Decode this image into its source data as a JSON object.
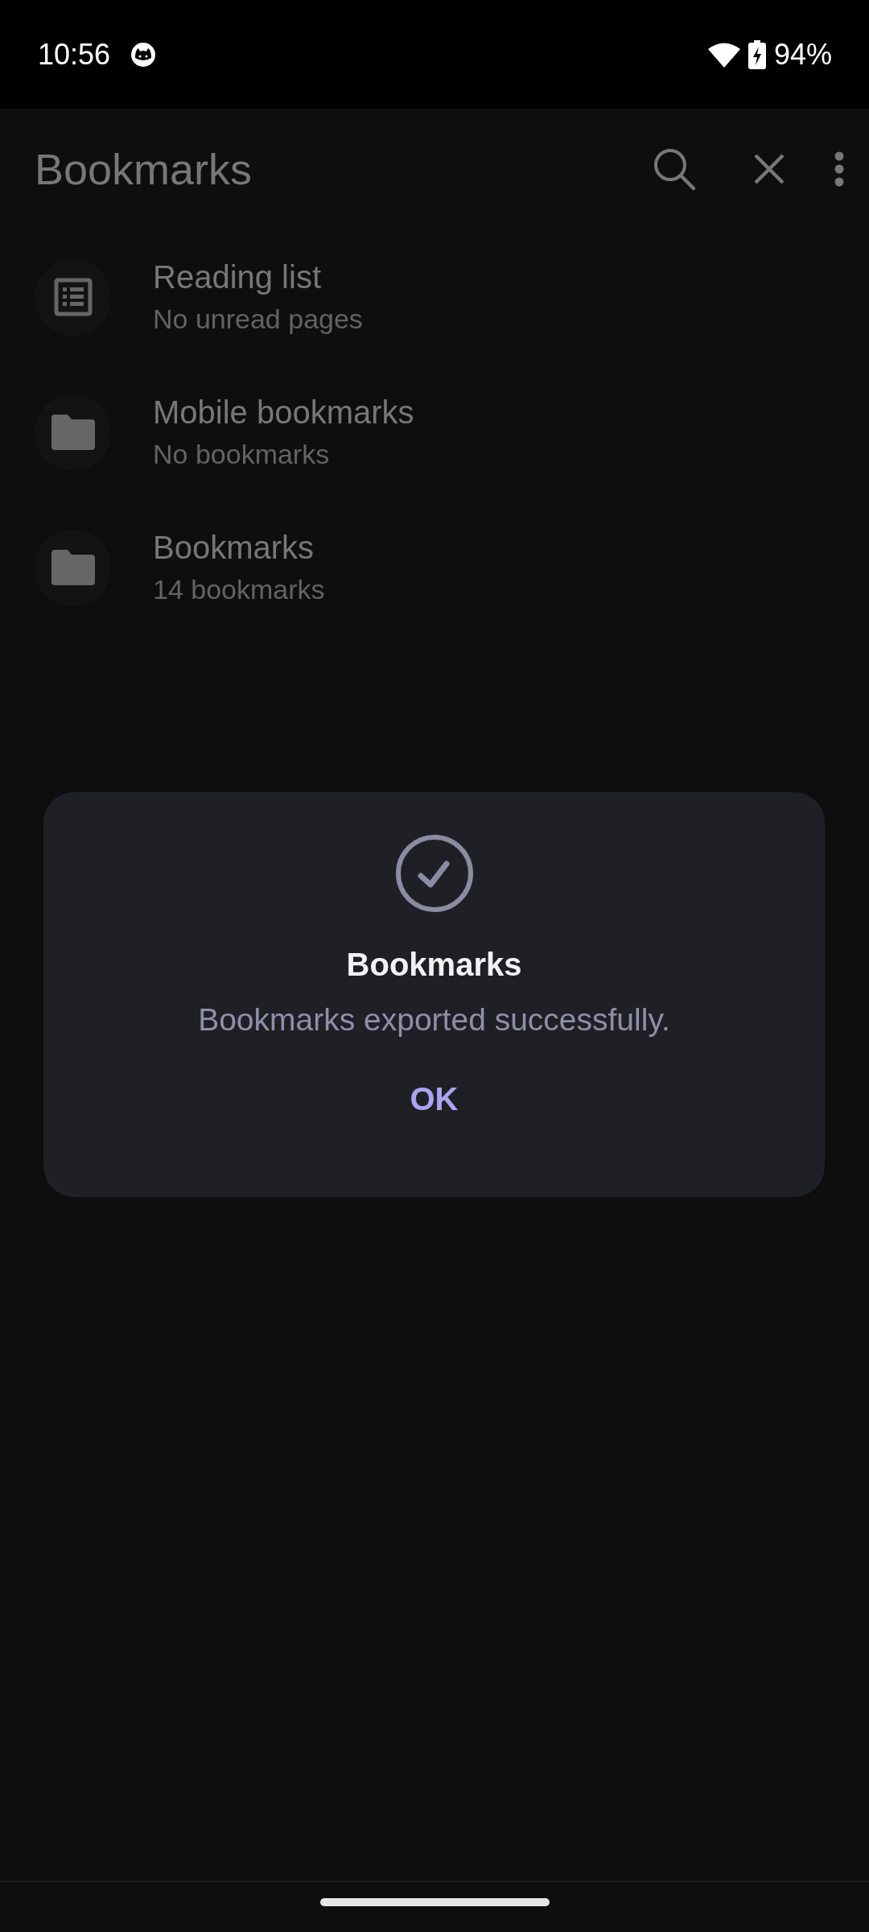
{
  "status_bar": {
    "time": "10:56",
    "battery": "94%"
  },
  "app_bar": {
    "title": "Bookmarks"
  },
  "items": [
    {
      "kind": "list",
      "title": "Reading list",
      "subtitle": "No unread pages"
    },
    {
      "kind": "folder",
      "title": "Mobile bookmarks",
      "subtitle": "No bookmarks"
    },
    {
      "kind": "folder",
      "title": "Bookmarks",
      "subtitle": "14 bookmarks"
    }
  ],
  "dialog": {
    "title": "Bookmarks",
    "message": "Bookmarks exported successfully.",
    "button": "OK"
  }
}
